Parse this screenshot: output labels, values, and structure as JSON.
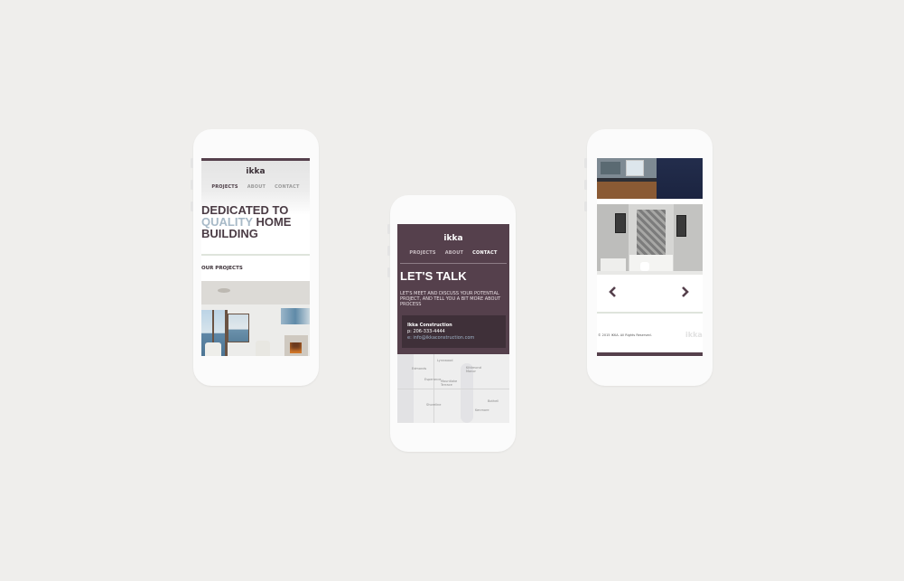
{
  "colors": {
    "brand": "#55404c",
    "accent": "#a7b9c7",
    "bg": "#efeeec"
  },
  "phone1": {
    "logo": "ikka",
    "nav": [
      "PROJECTS",
      "ABOUT",
      "CONTACT"
    ],
    "hero_line1": "DEDICATED TO",
    "hero_quality": "QUALITY",
    "hero_home": " HOME",
    "hero_line3": "BUILDING",
    "section_title": "OUR PROJECTS"
  },
  "phone2": {
    "logo": "ikka",
    "nav": [
      "PROJECTS",
      "ABOUT",
      "CONTACT"
    ],
    "title": "LET'S TALK",
    "subtitle": "LET'S MEET AND DISCUSS YOUR POTENTIAL PROJECT, AND TELL YOU A BIT MORE ABOUT PROCESS",
    "company": "Ikka Construction",
    "phone": "p: 206-333-4444",
    "email": "e: info@ikkaconstruction.com",
    "map_labels": [
      "Lynnwood",
      "Edmonds",
      "Kittimond Manor",
      "Esperance",
      "Mountlake Terrace",
      "Shoreline",
      "Bothell",
      "Kenmore"
    ]
  },
  "phone3": {
    "copyright": "© 2015 IKKA. All Rights Reserved.",
    "logo": "ikka",
    "prev_icon": "chevron-left-icon",
    "next_icon": "chevron-right-icon"
  }
}
